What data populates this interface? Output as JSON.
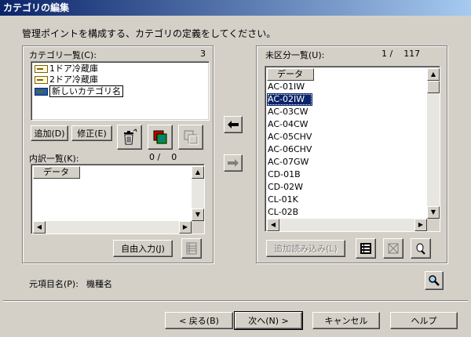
{
  "window": {
    "title": "カテゴリの編集"
  },
  "instruction": "管理ポイントを構成する、カテゴリの定義をしてください。",
  "category_panel": {
    "label": "カテゴリ一覧(C):",
    "count": "3",
    "items": [
      "1ドア冷蔵庫",
      "2ドア冷蔵庫",
      "新しいカテゴリ名"
    ],
    "add_button": "追加(D)",
    "modify_button": "修正(E)"
  },
  "breakdown_panel": {
    "label": "内訳一覧(K):",
    "count": "0 /    0",
    "column_header": "データ",
    "free_input_button": "自由入力(J)"
  },
  "unclassified_panel": {
    "label": "未区分一覧(U):",
    "count": "1 /    117",
    "column_header": "データ",
    "items": [
      "AC-01IW",
      "AC-02IW",
      "AC-03CW",
      "AC-04CW",
      "AC-05CHV",
      "AC-06CHV",
      "AC-07GW",
      "CD-01B",
      "CD-02W",
      "CL-01K",
      "CL-02B"
    ],
    "selected_index": 1,
    "load_more_button": "追加読み込み(L)"
  },
  "source_field": {
    "label": "元項目名(P):",
    "value": "機種名"
  },
  "footer": {
    "back_button": "< 戻る(B)",
    "next_button": "次へ(N) >",
    "cancel_button": "キャンセル",
    "help_button": "ヘルプ"
  },
  "icons": {
    "delete": "trash-icon",
    "select_all": "select-all-icon",
    "copy": "copy-icon",
    "move_left": "arrow-left-icon",
    "move_right": "arrow-right-icon",
    "list_view": "list-view-icon",
    "clear": "clear-icon",
    "zoom": "zoom-icon",
    "search": "search-icon"
  }
}
